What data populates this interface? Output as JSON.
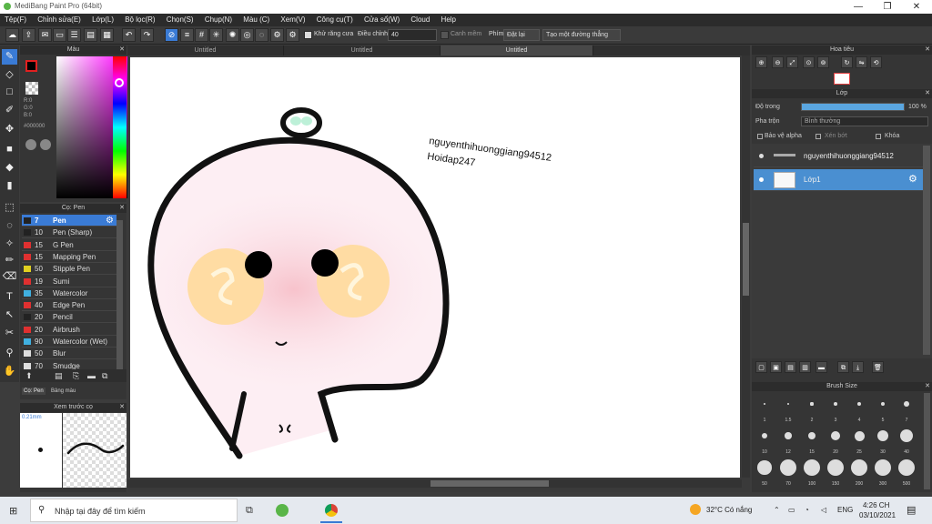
{
  "window": {
    "title": "MediBang Paint Pro (64bit)",
    "minimize": "—",
    "restore": "❐",
    "close": "✕"
  },
  "menu": [
    "Tệp(F)",
    "Chỉnh sửa(E)",
    "Lớp(L)",
    "Bộ lọc(R)",
    "Chọn(S)",
    "Chụp(N)",
    "Màu (C)",
    "Xem(V)",
    "Công cụ(T)",
    "Cửa sổ(W)",
    "Cloud",
    "Help"
  ],
  "toolbar": {
    "antialias_label": "Khử răng cưa",
    "adjust_label": "Điều chỉnh",
    "adjust_value": "40",
    "smooth_label": "Canh mềm",
    "keys_label": "Phím",
    "reset_label": "Đặt lại",
    "ruler_label": "Tạo một đường thẳng"
  },
  "tabs": [
    "Untitled",
    "Untitled",
    "Untitled"
  ],
  "color_panel": {
    "title": "Màu",
    "r": "R:0",
    "g": "G:0",
    "b": "B:0",
    "hex": "#000000",
    "primary": "#000000",
    "secondary": "#ffffff"
  },
  "brush_panel": {
    "title": "Cọ: Pen",
    "items": [
      {
        "size": "7",
        "name": "Pen",
        "color": "#222222",
        "selected": true
      },
      {
        "size": "10",
        "name": "Pen (Sharp)",
        "color": "#222222"
      },
      {
        "size": "15",
        "name": "G Pen",
        "color": "#e03030"
      },
      {
        "size": "15",
        "name": "Mapping Pen",
        "color": "#e03030"
      },
      {
        "size": "50",
        "name": "Stipple Pen",
        "color": "#e0d020"
      },
      {
        "size": "19",
        "name": "Sumi",
        "color": "#e03030"
      },
      {
        "size": "35",
        "name": "Watercolor",
        "color": "#40b0e0"
      },
      {
        "size": "40",
        "name": "Edge Pen",
        "color": "#e03030"
      },
      {
        "size": "20",
        "name": "Pencil",
        "color": "#222222"
      },
      {
        "size": "20",
        "name": "Airbrush",
        "color": "#e03030"
      },
      {
        "size": "90",
        "name": "Watercolor (Wet)",
        "color": "#40b0e0"
      },
      {
        "size": "50",
        "name": "Blur",
        "color": "#dddddd"
      },
      {
        "size": "70",
        "name": "Smudge",
        "color": "#dddddd"
      }
    ],
    "tab1": "Cọ: Pen",
    "tab2": "Bảng màu"
  },
  "preview_panel": {
    "title": "Xem trước cọ",
    "size": "0.21mm"
  },
  "canvas_text": {
    "line1": "nguyenthihuonggiang94512",
    "line2": "Hoidap247"
  },
  "right_panel": {
    "navigator_title": "Hoa tiêu",
    "layer_title": "Lớp",
    "opacity_label": "Độ trong",
    "opacity_value": "100 %",
    "opacity": 1.0,
    "blend_label": "Pha trộn",
    "blend_value": "Bình thường",
    "protect_alpha": "Bảo vệ alpha",
    "clipping": "Xén bớt",
    "lock": "Khóa",
    "layers": [
      {
        "name": "nguyenthihuonggiang94512",
        "selected": false
      },
      {
        "name": "Lớp1",
        "selected": true
      }
    ],
    "brush_size_title": "Brush Size",
    "sizes": [
      "1",
      "1.5",
      "2",
      "3",
      "4",
      "5",
      "7",
      "10",
      "12",
      "15",
      "20",
      "25",
      "30",
      "40",
      "50",
      "70",
      "100",
      "150",
      "200",
      "300",
      "500"
    ]
  },
  "taskbar": {
    "search_placeholder": "Nhập tại đây để tìm kiếm",
    "weather": "32°C Có nắng",
    "lang": "ENG",
    "time": "4:26 CH",
    "date": "03/10/2021"
  }
}
